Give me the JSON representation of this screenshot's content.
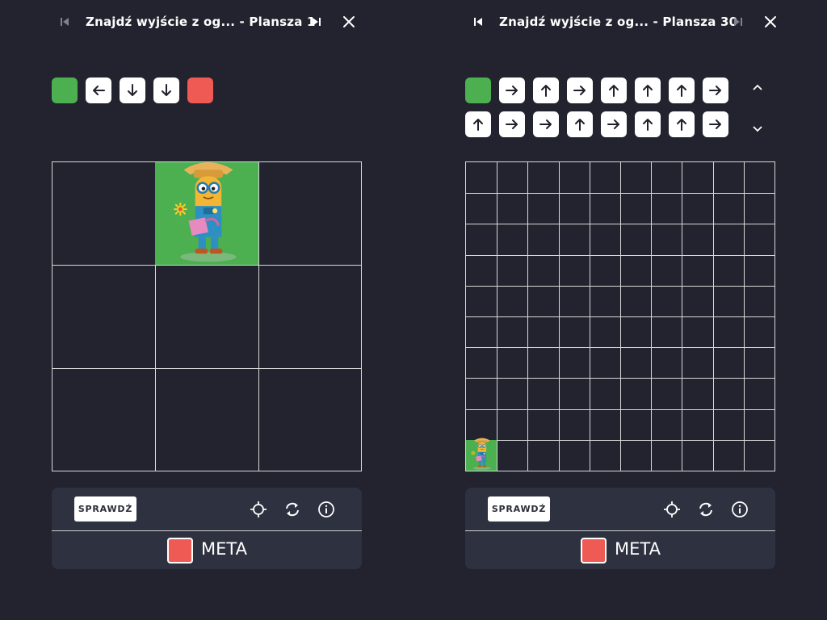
{
  "panels": [
    {
      "title": "Znajdź wyjście z og... - Plansza 1",
      "commands_row1": [
        "start",
        "left",
        "down",
        "down",
        "end"
      ],
      "grid_size": 3,
      "start_cell": {
        "col": 1,
        "row": 0
      },
      "check_label": "SPRAWDŹ",
      "goal_label": "META"
    },
    {
      "title": "Znajdź wyjście z og... - Plansza 30",
      "commands_row1": [
        "start",
        "right",
        "up",
        "right",
        "up",
        "up",
        "up",
        "right"
      ],
      "commands_row2": [
        "up",
        "right",
        "right",
        "up",
        "right",
        "up",
        "up",
        "right"
      ],
      "grid_size": 10,
      "start_cell": {
        "col": 0,
        "row": 9
      },
      "check_label": "SPRAWDŹ",
      "goal_label": "META"
    }
  ],
  "icons": {
    "first": "skip-first-icon",
    "last": "skip-last-icon",
    "close": "close-icon",
    "target": "crosshair-icon",
    "reset": "reset-icon",
    "info": "info-icon",
    "scroll_up": "chevron-up-icon",
    "scroll_down": "chevron-down-icon"
  },
  "colors": {
    "background": "#22232e",
    "toolbar": "#2e3140",
    "start": "#4caf50",
    "end": "#ef5a55"
  }
}
